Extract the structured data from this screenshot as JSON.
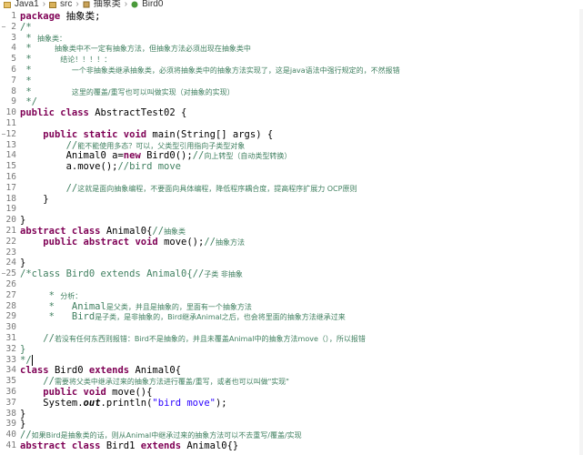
{
  "breadcrumb": {
    "items": [
      "Java1",
      "src",
      "抽象类",
      "Bird0"
    ],
    "separator": "›"
  },
  "editor": {
    "lines": [
      {
        "n": "1",
        "parts": [
          {
            "t": "package ",
            "k": "kw"
          },
          {
            "t": "抽象类;",
            "k": "n"
          }
        ]
      },
      {
        "n": "2",
        "parts": [
          {
            "t": "/*",
            "k": "c"
          }
        ]
      },
      {
        "n": "3",
        "parts": [
          {
            "t": " * ",
            "k": "c"
          },
          {
            "t": "抽象类：",
            "k": "cj"
          }
        ]
      },
      {
        "n": "4",
        "parts": [
          {
            "t": " *    ",
            "k": "c"
          },
          {
            "t": "抽象类中不一定有抽象方法，但抽象方法必须出现在抽象类中",
            "k": "cj"
          }
        ]
      },
      {
        "n": "5",
        "parts": [
          {
            "t": " *     ",
            "k": "c"
          },
          {
            "t": "结论！！！！：",
            "k": "cj"
          }
        ]
      },
      {
        "n": "6",
        "parts": [
          {
            "t": " *       ",
            "k": "c"
          },
          {
            "t": "一个非抽象类继承抽象类，必须将抽象类中的抽象方法实现了，这是java语法中强行规定的，不然报错",
            "k": "cj"
          }
        ]
      },
      {
        "n": "7",
        "parts": [
          {
            "t": " *",
            "k": "c"
          }
        ]
      },
      {
        "n": "8",
        "parts": [
          {
            "t": " *       ",
            "k": "c"
          },
          {
            "t": "这里的覆盖/重写也可以叫做实现（对抽象的实现）",
            "k": "cj"
          }
        ]
      },
      {
        "n": "9",
        "parts": [
          {
            "t": " */",
            "k": "c"
          }
        ]
      },
      {
        "n": "10",
        "parts": [
          {
            "t": "public class ",
            "k": "kw"
          },
          {
            "t": "AbstractTest02 {",
            "k": "n"
          }
        ]
      },
      {
        "n": "11",
        "parts": []
      },
      {
        "n": "12",
        "parts": [
          {
            "t": "    ",
            "k": "n"
          },
          {
            "t": "public static void ",
            "k": "kw"
          },
          {
            "t": "main(String[] args) {",
            "k": "n"
          }
        ]
      },
      {
        "n": "13",
        "parts": [
          {
            "t": "        //",
            "k": "c"
          },
          {
            "t": "能不能使用多态？可以，父类型引用指向子类型对象",
            "k": "cj"
          }
        ]
      },
      {
        "n": "14",
        "parts": [
          {
            "t": "        Animal0 a=",
            "k": "n"
          },
          {
            "t": "new ",
            "k": "kw"
          },
          {
            "t": "Bird0();",
            "k": "n"
          },
          {
            "t": "//",
            "k": "c"
          },
          {
            "t": "向上转型（自动类型转换）",
            "k": "cj"
          }
        ]
      },
      {
        "n": "15",
        "parts": [
          {
            "t": "        a.move();",
            "k": "n"
          },
          {
            "t": "//bird move",
            "k": "c"
          }
        ]
      },
      {
        "n": "16",
        "parts": []
      },
      {
        "n": "17",
        "parts": [
          {
            "t": "        //",
            "k": "c"
          },
          {
            "t": "这就是面向抽象编程，不要面向具体编程，降低程序耦合度，提高程序扩展力 OCP原则",
            "k": "cj"
          }
        ]
      },
      {
        "n": "18",
        "parts": [
          {
            "t": "    }",
            "k": "n"
          }
        ]
      },
      {
        "n": "19",
        "parts": []
      },
      {
        "n": "20",
        "parts": [
          {
            "t": "}",
            "k": "n"
          }
        ]
      },
      {
        "n": "21",
        "parts": [
          {
            "t": "abstract class ",
            "k": "kw"
          },
          {
            "t": "Animal0{",
            "k": "n"
          },
          {
            "t": "//",
            "k": "c"
          },
          {
            "t": "抽象类",
            "k": "cj"
          }
        ]
      },
      {
        "n": "22",
        "parts": [
          {
            "t": "    ",
            "k": "n"
          },
          {
            "t": "public abstract void ",
            "k": "kw"
          },
          {
            "t": "move();",
            "k": "n"
          },
          {
            "t": "//",
            "k": "c"
          },
          {
            "t": "抽象方法",
            "k": "cj"
          }
        ]
      },
      {
        "n": "23",
        "parts": []
      },
      {
        "n": "24",
        "parts": [
          {
            "t": "}",
            "k": "n"
          }
        ]
      },
      {
        "n": "25",
        "parts": [
          {
            "t": "/*class Bird0 extends Animal0{//",
            "k": "c"
          },
          {
            "t": "子类 非抽象",
            "k": "cj"
          }
        ]
      },
      {
        "n": "26",
        "parts": []
      },
      {
        "n": "27",
        "parts": [
          {
            "t": "     * ",
            "k": "c"
          },
          {
            "t": "分析：",
            "k": "cj"
          }
        ]
      },
      {
        "n": "28",
        "parts": [
          {
            "t": "     *   Animal",
            "k": "c"
          },
          {
            "t": "是父类，并且是抽象的，里面有一个抽象方法",
            "k": "cj"
          }
        ]
      },
      {
        "n": "29",
        "parts": [
          {
            "t": "     *   Bird",
            "k": "c"
          },
          {
            "t": "是子类，是非抽象的，Bird继承Animal之后，也会将里面的抽象方法继承过来",
            "k": "cj"
          }
        ]
      },
      {
        "n": "30",
        "parts": []
      },
      {
        "n": "31",
        "parts": [
          {
            "t": "    //",
            "k": "c"
          },
          {
            "t": "若没有任何东西则报错：Bird不是抽象的，并且未覆盖Animal中的抽象方法move（），所以报错",
            "k": "cj"
          }
        ]
      },
      {
        "n": "32",
        "parts": [
          {
            "t": "}",
            "k": "c"
          }
        ]
      },
      {
        "n": "33",
        "parts": [
          {
            "t": "*/",
            "k": "c"
          },
          {
            "t": "",
            "k": "caret"
          }
        ]
      },
      {
        "n": "34",
        "parts": [
          {
            "t": "class ",
            "k": "kw"
          },
          {
            "t": "Bird0 ",
            "k": "n"
          },
          {
            "t": "extends ",
            "k": "kw"
          },
          {
            "t": "Animal0{",
            "k": "n"
          }
        ]
      },
      {
        "n": "35",
        "parts": [
          {
            "t": "    //",
            "k": "c"
          },
          {
            "t": "需要将父类中继承过来的抽象方法进行覆盖/重写，或者也可以叫做\"实现\"",
            "k": "cj"
          }
        ]
      },
      {
        "n": "36",
        "parts": [
          {
            "t": "    ",
            "k": "n"
          },
          {
            "t": "public void ",
            "k": "kw"
          },
          {
            "t": "move(){",
            "k": "n"
          }
        ]
      },
      {
        "n": "37",
        "parts": [
          {
            "t": "    System.",
            "k": "n"
          },
          {
            "t": "out",
            "k": "m"
          },
          {
            "t": ".println(",
            "k": "n"
          },
          {
            "t": "\"bird move\"",
            "k": "s"
          },
          {
            "t": ");",
            "k": "n"
          }
        ]
      },
      {
        "n": "38",
        "parts": [
          {
            "t": "}",
            "k": "n"
          }
        ]
      },
      {
        "n": "39",
        "parts": [
          {
            "t": "}",
            "k": "n"
          }
        ]
      },
      {
        "n": "40",
        "parts": [
          {
            "t": "//",
            "k": "c"
          },
          {
            "t": "如果Bird是抽象类的话，则从Animal中继承过来的抽象方法可以不去重写/覆盖/实现",
            "k": "cj"
          }
        ]
      },
      {
        "n": "41",
        "parts": [
          {
            "t": "abstract class ",
            "k": "kw"
          },
          {
            "t": "Bird1 ",
            "k": "n"
          },
          {
            "t": "extends ",
            "k": "kw"
          },
          {
            "t": "Animal0{}",
            "k": "n"
          }
        ]
      }
    ]
  }
}
